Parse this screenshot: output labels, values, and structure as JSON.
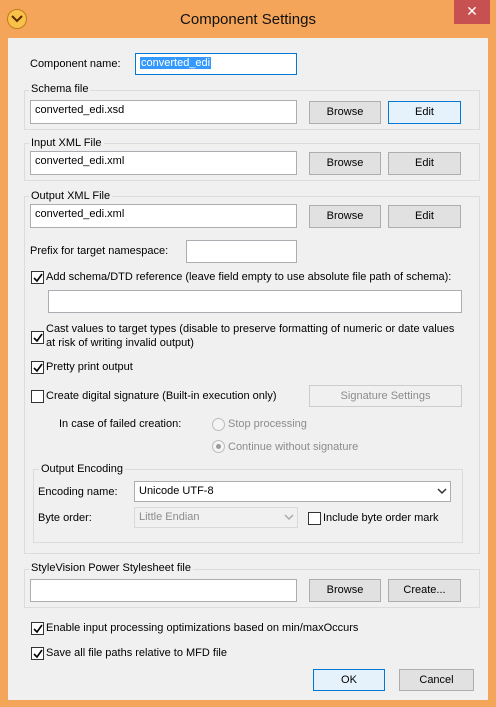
{
  "window": {
    "title": "Component Settings",
    "close_glyph": "✕"
  },
  "component_name": {
    "label": "Component name:",
    "value": "converted_edi"
  },
  "schema_file": {
    "label": "Schema file",
    "value": "converted_edi.xsd",
    "browse": "Browse",
    "edit": "Edit"
  },
  "input_xml": {
    "label": "Input XML File",
    "value": "converted_edi.xml",
    "browse": "Browse",
    "edit": "Edit"
  },
  "output_xml": {
    "label": "Output XML File",
    "value": "converted_edi.xml",
    "browse": "Browse",
    "edit": "Edit",
    "prefix_label": "Prefix for target namespace:",
    "prefix_value": "",
    "add_schema_ref": {
      "label": "Add schema/DTD reference (leave field empty to use absolute file path of schema):",
      "checked": true,
      "value": ""
    },
    "cast_values": {
      "label_line1": "Cast values to target types (disable to preserve formatting of numeric or date values",
      "label_line2": "at risk of writing invalid output)",
      "checked": true
    },
    "pretty_print": {
      "label": "Pretty print output",
      "checked": true
    },
    "digital_signature": {
      "label": "Create digital signature (Built-in execution only)",
      "checked": false,
      "settings_button": "Signature Settings"
    },
    "failed_creation": {
      "label": "In case of failed creation:",
      "options": [
        "Stop processing",
        "Continue without signature"
      ],
      "selected": "Continue without signature"
    },
    "encoding": {
      "group_label": "Output Encoding",
      "name_label": "Encoding name:",
      "name_value": "Unicode UTF-8",
      "byte_order_label": "Byte order:",
      "byte_order_value": "Little Endian",
      "bom_label": "Include byte order mark",
      "bom_checked": false
    }
  },
  "stylevision": {
    "label": "StyleVision Power Stylesheet file",
    "value": "",
    "browse": "Browse",
    "create": "Create..."
  },
  "enable_optimizations": {
    "label": "Enable input processing optimizations based on min/maxOccurs",
    "checked": true
  },
  "save_relative": {
    "label": "Save all file paths relative to MFD file",
    "checked": true
  },
  "footer": {
    "ok": "OK",
    "cancel": "Cancel"
  },
  "colors": {
    "frame": "#f5a55a",
    "close": "#c75050",
    "selection": "#3399ff",
    "focus": "#0078d7"
  },
  "icons": [
    "app-icon",
    "close-icon",
    "check-icon",
    "chevron-down-icon"
  ]
}
